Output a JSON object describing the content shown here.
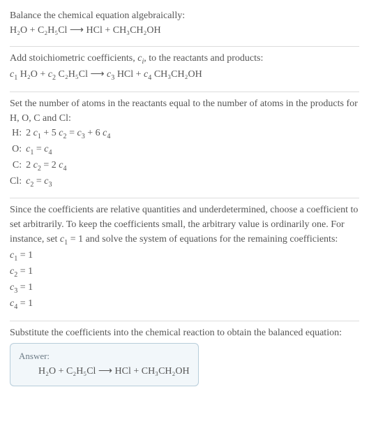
{
  "s1": {
    "line1": "Balance the chemical equation algebraically:",
    "eq": "H₂O + C₂H₅Cl ⟶ HCl + CH₃CH₂OH"
  },
  "s2": {
    "line1_a": "Add stoichiometric coefficients, ",
    "line1_var": "c",
    "line1_sub": "i",
    "line1_b": ", to the reactants and products:",
    "eq_c1": "c",
    "eq_c1s": "1",
    "eq_t1": " H₂O + ",
    "eq_c2": "c",
    "eq_c2s": "2",
    "eq_t2": " C₂H₅Cl ⟶ ",
    "eq_c3": "c",
    "eq_c3s": "3",
    "eq_t3": " HCl + ",
    "eq_c4": "c",
    "eq_c4s": "4",
    "eq_t4": " CH₃CH₂OH"
  },
  "s3": {
    "line1": "Set the number of atoms in the reactants equal to the number of atoms in the products for H, O, C and Cl:",
    "rows": {
      "H": {
        "lbl": "H:",
        "c1a": "2 ",
        "c1": "c",
        "c1s": "1",
        "plus": " + 5 ",
        "c2": "c",
        "c2s": "2",
        "eq": " = ",
        "c3": "c",
        "c3s": "3",
        "plus2": " + 6 ",
        "c4": "c",
        "c4s": "4"
      },
      "O": {
        "lbl": "O:",
        "c1": "c",
        "c1s": "1",
        "eq": " = ",
        "c4": "c",
        "c4s": "4"
      },
      "C": {
        "lbl": "C:",
        "c2a": "2 ",
        "c2": "c",
        "c2s": "2",
        "eq": " = 2 ",
        "c4": "c",
        "c4s": "4"
      },
      "Cl": {
        "lbl": "Cl:",
        "c2": "c",
        "c2s": "2",
        "eq": " = ",
        "c3": "c",
        "c3s": "3"
      }
    }
  },
  "s4": {
    "line1a": "Since the coefficients are relative quantities and underdetermined, choose a coefficient to set arbitrarily. To keep the coefficients small, the arbitrary value is ordinarily one. For instance, set ",
    "cvar": "c",
    "csub": "1",
    "line1b": " = 1 and solve the system of equations for the remaining coefficients:",
    "r1a": "c",
    "r1s": "1",
    "r1b": " = 1",
    "r2a": "c",
    "r2s": "2",
    "r2b": " = 1",
    "r3a": "c",
    "r3s": "3",
    "r3b": " = 1",
    "r4a": "c",
    "r4s": "4",
    "r4b": " = 1"
  },
  "s5": {
    "line1": "Substitute the coefficients into the chemical reaction to obtain the balanced equation:"
  },
  "answer": {
    "label": "Answer:",
    "eq": "H₂O + C₂H₅Cl ⟶ HCl + CH₃CH₂OH"
  }
}
